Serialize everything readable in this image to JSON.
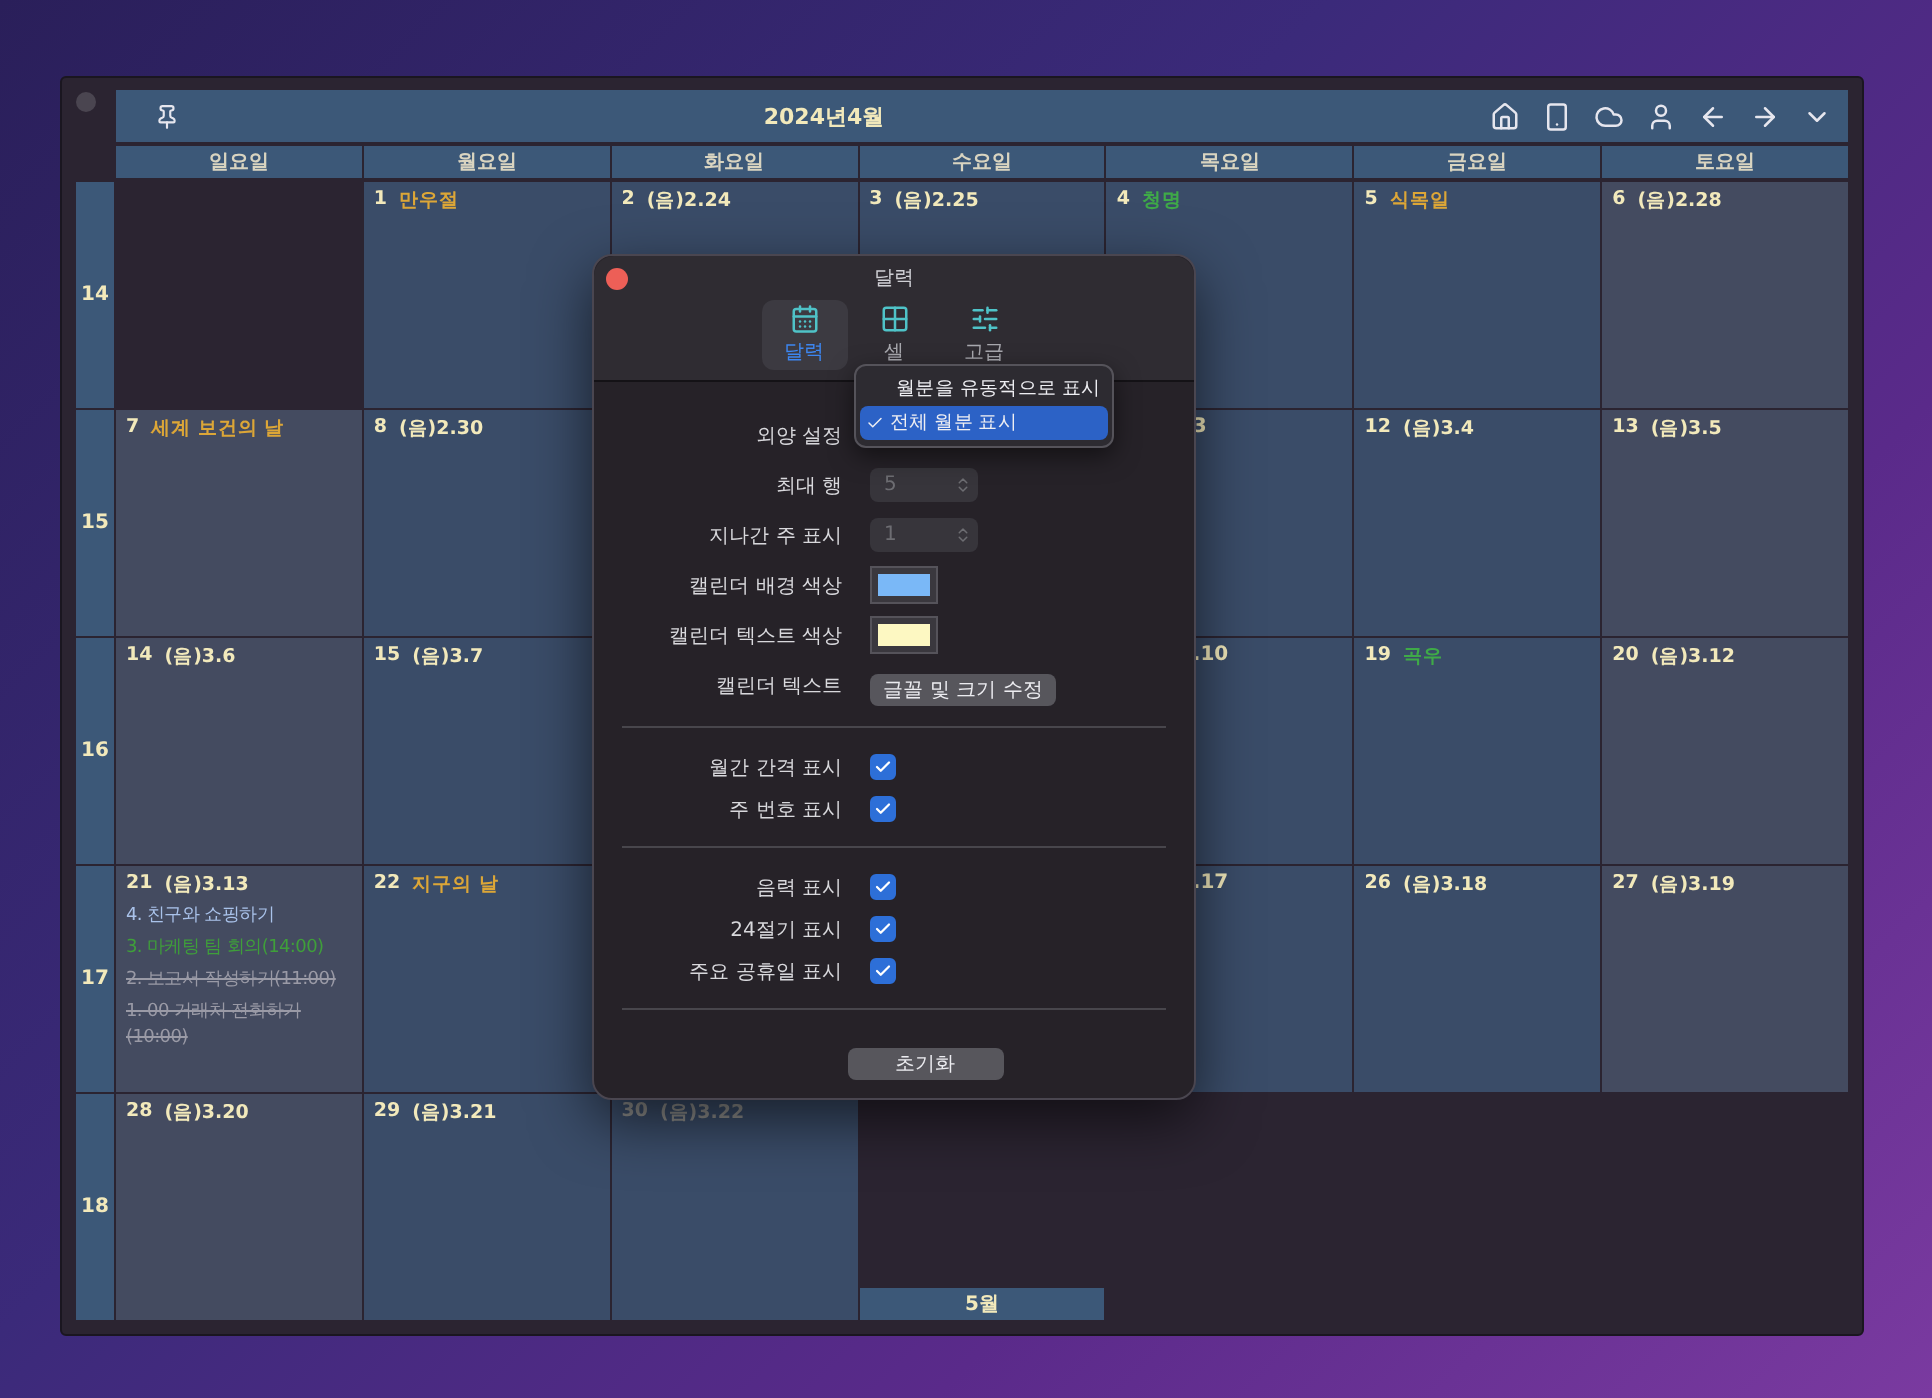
{
  "window": {
    "title": "2024년4월"
  },
  "weekdays": [
    "일요일",
    "월요일",
    "화요일",
    "수요일",
    "목요일",
    "금요일",
    "토요일"
  ],
  "weeks": [
    {
      "number": "14",
      "days": [
        {
          "kind": "empty"
        },
        {
          "kind": "weekday",
          "date": "1",
          "dimmed": false,
          "note": {
            "text": "만우절",
            "kind": "holiday"
          }
        },
        {
          "kind": "weekday",
          "date": "2",
          "dimmed": false,
          "note": {
            "text": "(음)2.24",
            "kind": "lunar"
          }
        },
        {
          "kind": "weekday",
          "date": "3",
          "dimmed": false,
          "note": {
            "text": "(음)2.25",
            "kind": "lunar"
          }
        },
        {
          "kind": "weekday",
          "date": "4",
          "dimmed": false,
          "note": {
            "text": "청명",
            "kind": "term"
          }
        },
        {
          "kind": "weekday",
          "date": "5",
          "dimmed": false,
          "note": {
            "text": "식목일",
            "kind": "holiday"
          }
        },
        {
          "kind": "weekend",
          "date": "6",
          "dimmed": false,
          "note": {
            "text": "(음)2.28",
            "kind": "lunar"
          }
        }
      ]
    },
    {
      "number": "15",
      "days": [
        {
          "kind": "weekend",
          "date": "7",
          "dimmed": false,
          "note": {
            "text": "세계 보건의 날",
            "kind": "holiday"
          }
        },
        {
          "kind": "weekday",
          "date": "8",
          "dimmed": false,
          "note": {
            "text": "(음)2.30",
            "kind": "lunar"
          }
        },
        {
          "kind": "weekday"
        },
        {
          "kind": "weekday"
        },
        {
          "kind": "weekday",
          "partial": "3"
        },
        {
          "kind": "weekday",
          "date": "12",
          "dimmed": false,
          "note": {
            "text": "(음)3.4",
            "kind": "lunar"
          }
        },
        {
          "kind": "weekend",
          "date": "13",
          "dimmed": false,
          "note": {
            "text": "(음)3.5",
            "kind": "lunar"
          }
        }
      ]
    },
    {
      "number": "16",
      "days": [
        {
          "kind": "weekend",
          "date": "14",
          "dimmed": false,
          "note": {
            "text": "(음)3.6",
            "kind": "lunar"
          }
        },
        {
          "kind": "weekday",
          "date": "15",
          "dimmed": false,
          "note": {
            "text": "(음)3.7",
            "kind": "lunar"
          }
        },
        {
          "kind": "weekday"
        },
        {
          "kind": "weekday"
        },
        {
          "kind": "weekday",
          "partial": ".10"
        },
        {
          "kind": "weekday",
          "date": "19",
          "dimmed": false,
          "note": {
            "text": "곡우",
            "kind": "term"
          }
        },
        {
          "kind": "weekend",
          "date": "20",
          "dimmed": false,
          "note": {
            "text": "(음)3.12",
            "kind": "lunar"
          }
        }
      ]
    },
    {
      "number": "17",
      "days": [
        {
          "kind": "weekend",
          "date": "21",
          "dimmed": false,
          "note": {
            "text": "(음)3.13",
            "kind": "lunar"
          },
          "events": [
            {
              "text": "4. 친구와 쇼핑하기",
              "done": false,
              "color": "#a9c2ea"
            },
            {
              "text": "3. 마케팅 팀 회의(14:00)",
              "done": false,
              "color": "#3f9f3a"
            },
            {
              "text": "2. 보고서 작성하기(11:00)",
              "done": true,
              "color": "#9a9aa6"
            },
            {
              "text": "1. 00 거래처 전화하기(10:00)",
              "done": true,
              "color": "#9a9aa6"
            }
          ]
        },
        {
          "kind": "weekday",
          "date": "22",
          "dimmed": false,
          "note": {
            "text": "지구의 날",
            "kind": "holiday"
          }
        },
        {
          "kind": "weekday"
        },
        {
          "kind": "weekday"
        },
        {
          "kind": "weekday",
          "partial": ".17"
        },
        {
          "kind": "weekday",
          "date": "26",
          "dimmed": false,
          "note": {
            "text": "(음)3.18",
            "kind": "lunar"
          }
        },
        {
          "kind": "weekend",
          "date": "27",
          "dimmed": false,
          "note": {
            "text": "(음)3.19",
            "kind": "lunar"
          }
        }
      ]
    },
    {
      "number": "18",
      "days": [
        {
          "kind": "weekend",
          "date": "28",
          "dimmed": false,
          "note": {
            "text": "(음)3.20",
            "kind": "lunar"
          }
        },
        {
          "kind": "weekday",
          "date": "29",
          "dimmed": false,
          "note": {
            "text": "(음)3.21",
            "kind": "lunar"
          }
        },
        {
          "kind": "weekday",
          "date": "30",
          "dimmed": true,
          "note": {
            "text": "(음)3.22",
            "kind": "lunar"
          }
        },
        {
          "kind": "empty",
          "footer": "5월"
        },
        {
          "kind": "empty"
        },
        {
          "kind": "empty"
        },
        {
          "kind": "empty"
        }
      ]
    }
  ],
  "dialog": {
    "title": "달력",
    "tabs": [
      {
        "label": "달력",
        "selected": true
      },
      {
        "label": "셀",
        "selected": false
      },
      {
        "label": "고급",
        "selected": false
      }
    ],
    "settings": [
      {
        "label": "외양 설정",
        "kind": "popup",
        "options": [
          {
            "label": "월분을 유동적으로 표시",
            "selected": false
          },
          {
            "label": "전체 월분 표시",
            "selected": true
          }
        ]
      },
      {
        "label": "최대 행",
        "kind": "stepper",
        "value": "5",
        "disabled": true
      },
      {
        "label": "지나간 주 표시",
        "kind": "stepper",
        "value": "1",
        "disabled": true
      },
      {
        "label": "캘린더 배경 색상",
        "kind": "color",
        "color": "#7ab8f7"
      },
      {
        "label": "캘린더 텍스트 색상",
        "kind": "color",
        "color": "#fdf8c2"
      },
      {
        "label": "캘린더 텍스트",
        "kind": "button",
        "button": "글꼴 및 크기 수정"
      }
    ],
    "checkbox_groups": [
      [
        {
          "label": "월간 간격 표시",
          "checked": true
        },
        {
          "label": "주 번호 표시",
          "checked": true
        }
      ],
      [
        {
          "label": "음력 표시",
          "checked": true
        },
        {
          "label": "24절기 표시",
          "checked": true
        },
        {
          "label": "주요 공휴일 표시",
          "checked": true
        }
      ]
    ],
    "reset_button": "초기화"
  }
}
